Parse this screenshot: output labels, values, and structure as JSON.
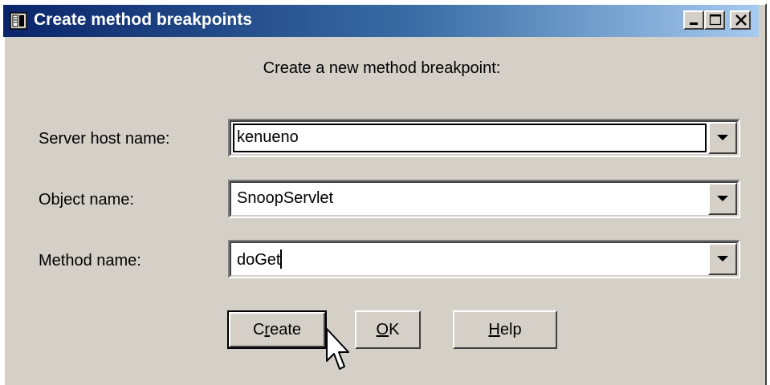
{
  "window": {
    "title": "Create method breakpoints",
    "controls": {
      "minimize": "minimize",
      "maximize": "maximize",
      "close": "close"
    }
  },
  "dialog": {
    "heading": "Create a new method breakpoint:",
    "fields": [
      {
        "label": "Server host name:",
        "value": "kenueno"
      },
      {
        "label": "Object name:",
        "value": "SnoopServlet"
      },
      {
        "label": "Method name:",
        "value": "doGet"
      }
    ],
    "buttons": {
      "create": {
        "pre": "C",
        "mnemonic": "r",
        "post": "eate"
      },
      "ok": {
        "pre": "",
        "mnemonic": "O",
        "post": "K"
      },
      "help": {
        "pre": "",
        "mnemonic": "H",
        "post": "elp"
      }
    }
  },
  "icons": {
    "title_icon": "dialog-app-icon",
    "dropdown": "chevron-down-icon",
    "cursor": "mouse-pointer-icon"
  },
  "colors": {
    "titlebar_start": "#0a246a",
    "titlebar_end": "#a6caf0",
    "face": "#d4d0c8"
  }
}
